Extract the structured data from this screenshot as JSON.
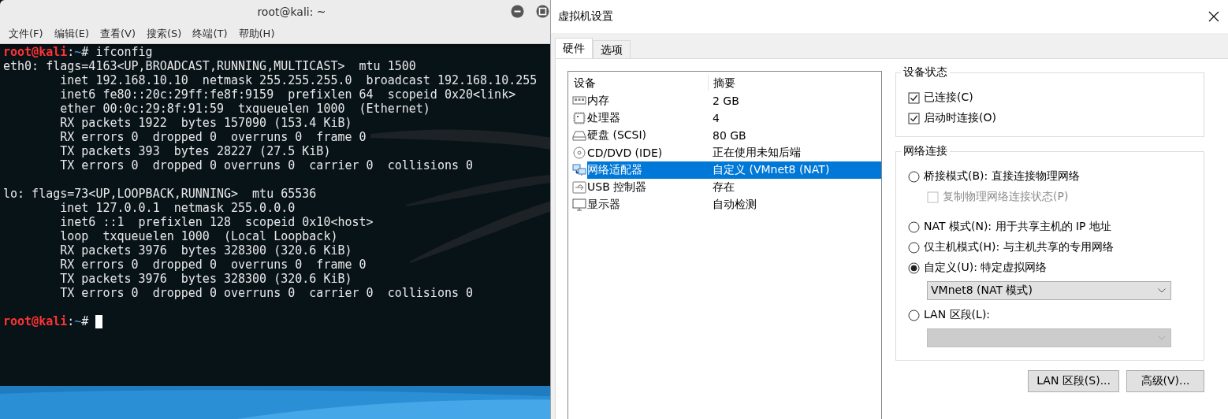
{
  "terminal": {
    "title": "root@kali: ~",
    "menu": [
      "文件(F)",
      "编辑(E)",
      "查看(V)",
      "搜索(S)",
      "终端(T)",
      "帮助(H)"
    ],
    "lines": [
      {
        "kind": "prompt",
        "user": "root@kali",
        "sep": ":",
        "path": "~",
        "symbol": "#",
        "command": " ifconfig"
      },
      {
        "kind": "output",
        "text": "eth0: flags=4163<UP,BROADCAST,RUNNING,MULTICAST>  mtu 1500"
      },
      {
        "kind": "output",
        "text": "        inet 192.168.10.10  netmask 255.255.255.0  broadcast 192.168.10.255"
      },
      {
        "kind": "output",
        "text": "        inet6 fe80::20c:29ff:fe8f:9159  prefixlen 64  scopeid 0x20<link>"
      },
      {
        "kind": "output",
        "text": "        ether 00:0c:29:8f:91:59  txqueuelen 1000  (Ethernet)"
      },
      {
        "kind": "output",
        "text": "        RX packets 1922  bytes 157090 (153.4 KiB)"
      },
      {
        "kind": "output",
        "text": "        RX errors 0  dropped 0  overruns 0  frame 0"
      },
      {
        "kind": "output",
        "text": "        TX packets 393  bytes 28227 (27.5 KiB)"
      },
      {
        "kind": "output",
        "text": "        TX errors 0  dropped 0 overruns 0  carrier 0  collisions 0"
      },
      {
        "kind": "blank"
      },
      {
        "kind": "output",
        "text": "lo: flags=73<UP,LOOPBACK,RUNNING>  mtu 65536"
      },
      {
        "kind": "output",
        "text": "        inet 127.0.0.1  netmask 255.0.0.0"
      },
      {
        "kind": "output",
        "text": "        inet6 ::1  prefixlen 128  scopeid 0x10<host>"
      },
      {
        "kind": "output",
        "text": "        loop  txqueuelen 1000  (Local Loopback)"
      },
      {
        "kind": "output",
        "text": "        RX packets 3976  bytes 328300 (320.6 KiB)"
      },
      {
        "kind": "output",
        "text": "        RX errors 0  dropped 0  overruns 0  frame 0"
      },
      {
        "kind": "output",
        "text": "        TX packets 3976  bytes 328300 (320.6 KiB)"
      },
      {
        "kind": "output",
        "text": "        TX errors 0  dropped 0 overruns 0  carrier 0  collisions 0"
      },
      {
        "kind": "blank"
      },
      {
        "kind": "prompt",
        "user": "root@kali",
        "sep": ":",
        "path": "~",
        "symbol": "#",
        "cursor": true
      }
    ]
  },
  "dialog": {
    "title": "虚拟机设置",
    "tabs": [
      {
        "label": "硬件",
        "selected": true
      },
      {
        "label": "选项",
        "selected": false
      }
    ],
    "device_table": {
      "columns": [
        "设备",
        "摘要"
      ],
      "rows": [
        {
          "kind": "memory",
          "device": "内存",
          "summary": "2 GB",
          "selected": false
        },
        {
          "kind": "processor",
          "device": "处理器",
          "summary": "4",
          "selected": false
        },
        {
          "kind": "disk",
          "device": "硬盘 (SCSI)",
          "summary": "80 GB",
          "selected": false
        },
        {
          "kind": "cd",
          "device": "CD/DVD (IDE)",
          "summary": "正在使用未知后端",
          "selected": false
        },
        {
          "kind": "network",
          "device": "网络适配器",
          "summary": "自定义 (VMnet8 (NAT)",
          "selected": true
        },
        {
          "kind": "usb",
          "device": "USB 控制器",
          "summary": "存在",
          "selected": false
        },
        {
          "kind": "display",
          "device": "显示器",
          "summary": "自动检测",
          "selected": false
        }
      ]
    },
    "device_status": {
      "title": "设备状态",
      "options": [
        {
          "label": "已连接(C)",
          "checked": true,
          "disabled": false
        },
        {
          "label": "启动时连接(O)",
          "checked": true,
          "disabled": false
        }
      ]
    },
    "network_connection": {
      "title": "网络连接",
      "options": [
        {
          "kind": "radio",
          "label": "桥接模式(B): 直接连接物理网络",
          "selected": false
        },
        {
          "kind": "checkbox",
          "label": "复制物理网络连接状态(P)",
          "checked": false,
          "disabled": true
        },
        {
          "kind": "radio",
          "label": "NAT 模式(N): 用于共享主机的 IP 地址",
          "selected": false
        },
        {
          "kind": "radio",
          "label": "仅主机模式(H): 与主机共享的专用网络",
          "selected": false
        },
        {
          "kind": "radio",
          "label": "自定义(U): 特定虚拟网络",
          "selected": true
        },
        {
          "kind": "dropdown",
          "value": "VMnet8 (NAT 模式)",
          "disabled": false
        },
        {
          "kind": "radio",
          "label": "LAN 区段(L):",
          "selected": false
        },
        {
          "kind": "dropdown",
          "disabled": true
        }
      ]
    },
    "buttons": [
      "LAN 区段(S)...",
      "高级(V)..."
    ]
  }
}
